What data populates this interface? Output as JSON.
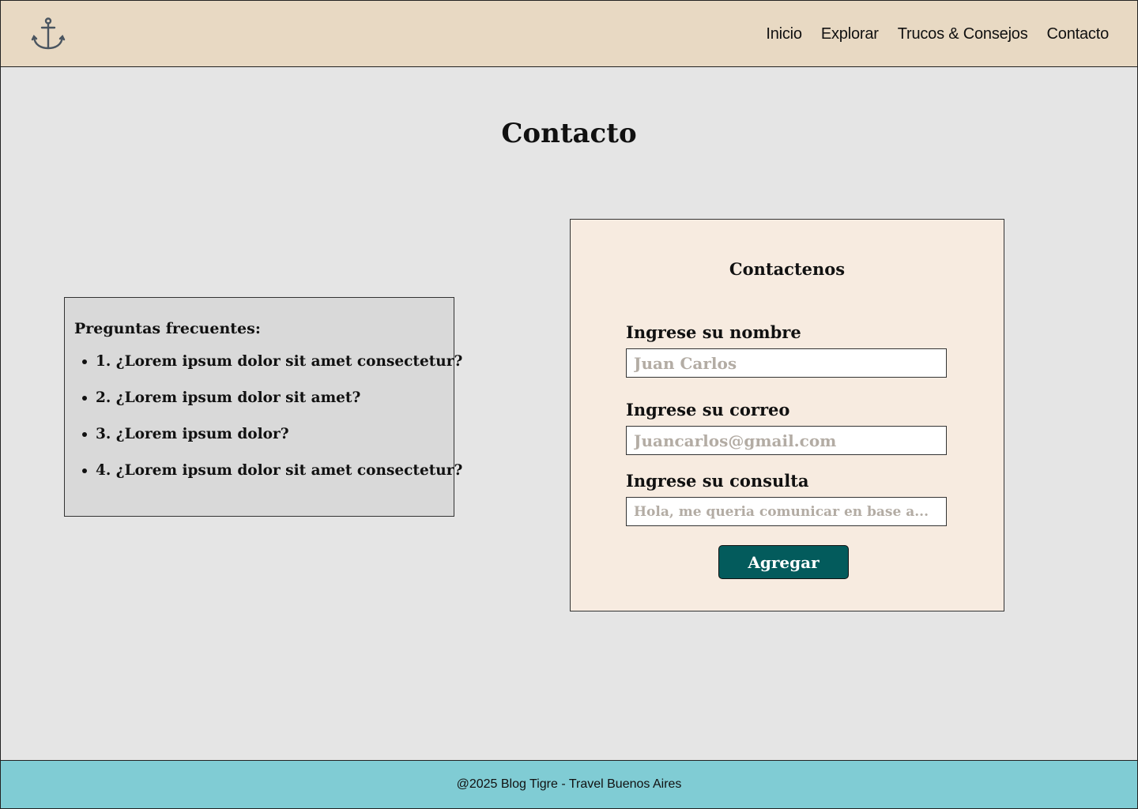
{
  "header": {
    "logo_icon": "anchor-icon",
    "nav": [
      {
        "label": "Inicio"
      },
      {
        "label": "Explorar"
      },
      {
        "label": "Trucos & Consejos"
      },
      {
        "label": "Contacto"
      }
    ]
  },
  "main": {
    "title": "Contacto"
  },
  "faq": {
    "title": "Preguntas frecuentes:",
    "items": [
      {
        "label": "1. ¿Lorem ipsum dolor sit amet consectetur?"
      },
      {
        "label": "2. ¿Lorem ipsum dolor sit amet?"
      },
      {
        "label": "3. ¿Lorem ipsum dolor?"
      },
      {
        "label": "4. ¿Lorem ipsum dolor sit amet consectetur?"
      }
    ]
  },
  "form": {
    "title": "Contactenos",
    "name_label": "Ingrese su nombre",
    "name_placeholder": "Juan Carlos",
    "email_label": "Ingrese su correo",
    "email_placeholder": "Juancarlos@gmail.com",
    "query_label": "Ingrese su consulta",
    "query_placeholder": "Hola, me queria comunicar en base a...",
    "submit_label": "Agregar"
  },
  "footer": {
    "text": "@2025 Blog Tigre - Travel Buenos Aires"
  },
  "colors": {
    "header_bg": "#e8d9c3",
    "page_bg": "#e5e5e5",
    "faq_bg": "#d9d9d9",
    "form_bg": "#f7ebe0",
    "button_bg": "#035b5c",
    "footer_bg": "#80ccd4"
  }
}
